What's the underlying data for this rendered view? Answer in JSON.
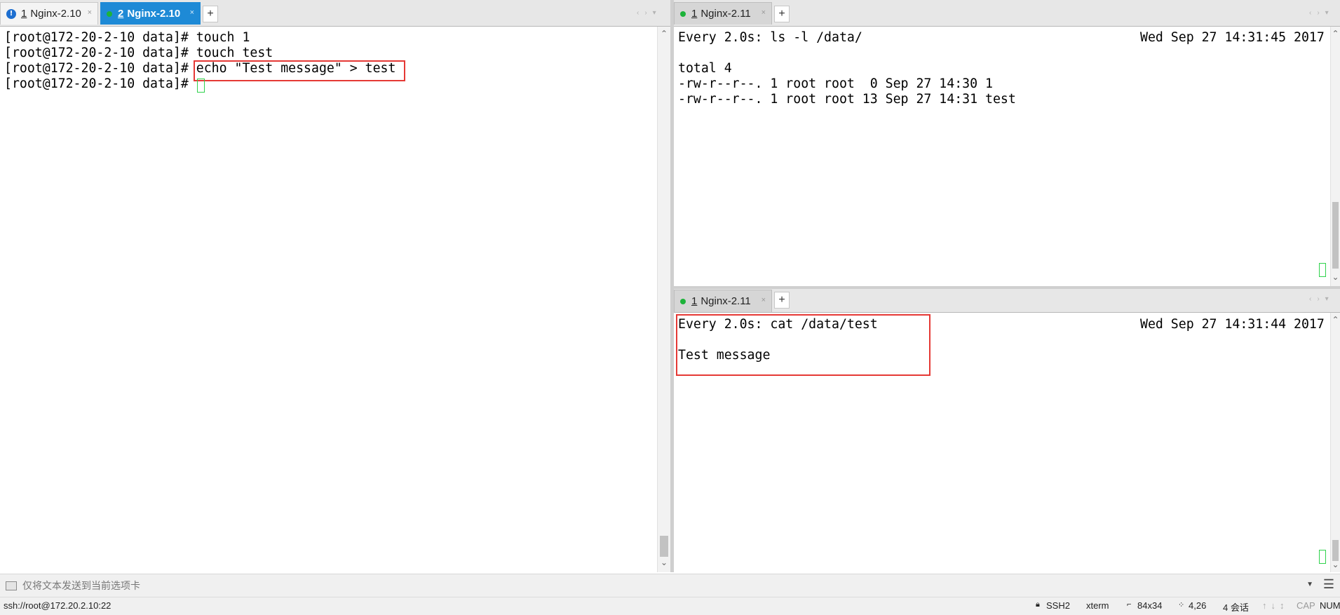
{
  "left_tabbar": {
    "tabs": [
      {
        "num": "1",
        "label": "Nginx-2.10",
        "status": "info",
        "active": false
      },
      {
        "num": "2",
        "label": "Nginx-2.10",
        "status": "connected",
        "active": true
      }
    ],
    "add_label": "+",
    "close_glyph": "×"
  },
  "left_terminal": {
    "lines": [
      "[root@172-20-2-10 data]# touch 1",
      "[root@172-20-2-10 data]# touch test",
      "[root@172-20-2-10 data]# echo \"Test message\" > test",
      "[root@172-20-2-10 data]# "
    ]
  },
  "right_top_tabbar": {
    "tabs": [
      {
        "num": "1",
        "label": "Nginx-2.11",
        "status": "connected"
      }
    ],
    "add_label": "+"
  },
  "right_top_terminal": {
    "header_cmd": "Every 2.0s: ls -l /data/",
    "header_time": "Wed Sep 27 14:31:45 2017",
    "lines": [
      "total 4",
      "-rw-r--r--. 1 root root  0 Sep 27 14:30 1",
      "-rw-r--r--. 1 root root 13 Sep 27 14:31 test"
    ]
  },
  "right_bottom_tabbar": {
    "tabs": [
      {
        "num": "1",
        "label": "Nginx-2.11",
        "status": "connected"
      }
    ],
    "add_label": "+"
  },
  "right_bottom_terminal": {
    "header_cmd": "Every 2.0s: cat /data/test",
    "header_time": "Wed Sep 27 14:31:44 2017",
    "lines": [
      "Test message"
    ]
  },
  "send_bar": {
    "placeholder": "仅将文本发送到当前选项卡",
    "icon": "send-text-icon"
  },
  "status_bar": {
    "connection": "ssh://root@172.20.2.10:22",
    "protocol": "SSH2",
    "terminal_type": "xterm",
    "size": "84x34",
    "cursor_pos": "4,26",
    "sessions": "4 会话",
    "cap": "CAP",
    "num": "NUM"
  },
  "colors": {
    "accent": "#1e8ad6",
    "highlight": "#e53935",
    "cursor": "#2fd24c",
    "connected": "#1db33a",
    "info": "#1e6fd0"
  }
}
